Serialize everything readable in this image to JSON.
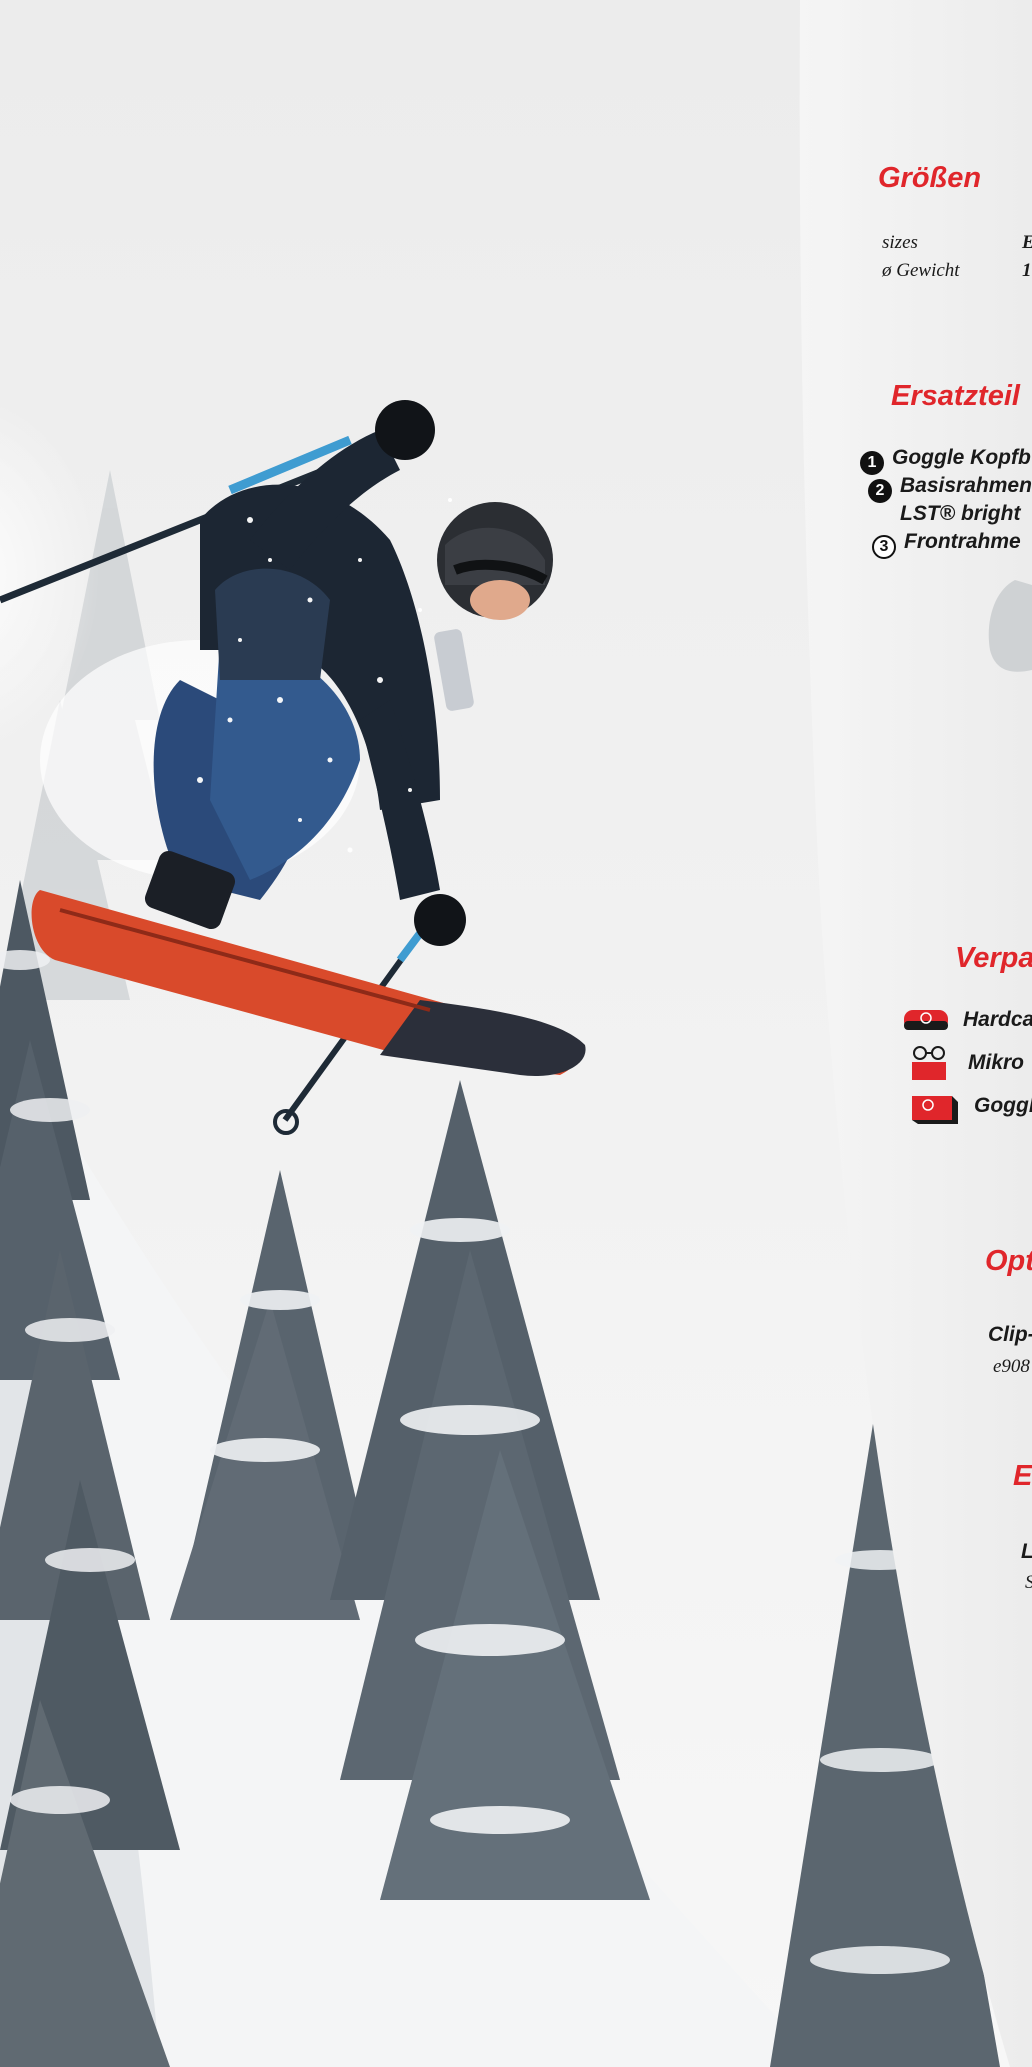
{
  "sections": {
    "sizes": {
      "heading": "Größen",
      "row1_label": "sizes",
      "row1_value": "E",
      "row2_label": "ø Gewicht",
      "row2_value": "1"
    },
    "spare_parts": {
      "heading": "Ersatzteil",
      "items": [
        {
          "num": "1",
          "label": "Goggle Kopfb"
        },
        {
          "num": "2",
          "label": "Basisrahmen"
        },
        {
          "num": "",
          "label": "LST® bright"
        },
        {
          "num": "3",
          "label": "Frontrahme"
        }
      ]
    },
    "packaging": {
      "heading": "Verpa",
      "items": [
        {
          "icon": "hardcase-icon",
          "label": "Hardca"
        },
        {
          "icon": "microfiber-glasses-icon",
          "label": "Mikro"
        },
        {
          "icon": "goggle-box-icon",
          "label": "Goggl"
        }
      ]
    },
    "optional": {
      "heading": "Opt",
      "item_label": "Clip-",
      "item_code": "e908"
    },
    "extra": {
      "heading": "E",
      "item_label": "L",
      "item_sub": "S"
    }
  },
  "colors": {
    "accent": "#e0262b",
    "panel_bg": "#f2f2f2",
    "text": "#1a1a1a"
  }
}
